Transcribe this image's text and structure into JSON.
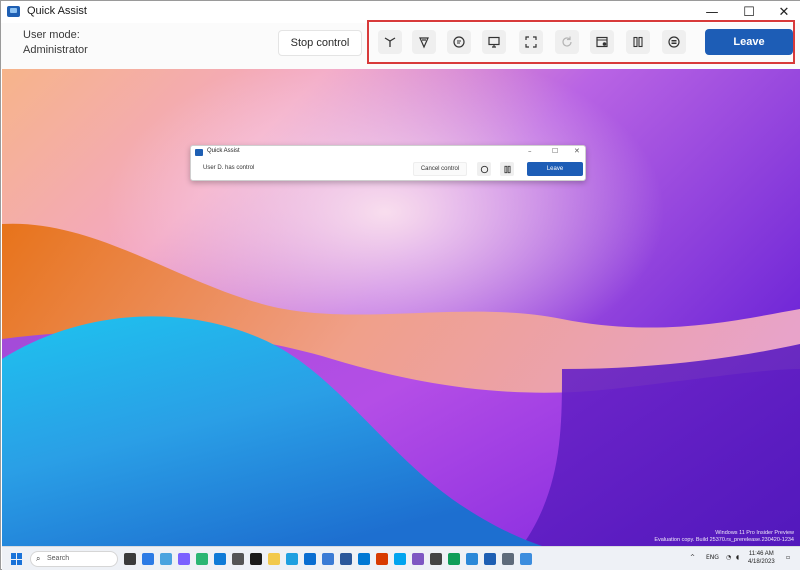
{
  "window": {
    "title": "Quick Assist",
    "controls": {
      "minimize": "—",
      "maximize": "☐",
      "close": "✕"
    }
  },
  "toolbar": {
    "user_mode_label": "User mode:",
    "user_mode_value": "Administrator",
    "stop_control_label": "Stop control",
    "leave_label": "Leave",
    "tools": [
      {
        "name": "laser-pointer-icon"
      },
      {
        "name": "annotate-icon"
      },
      {
        "name": "chat-icon"
      },
      {
        "name": "select-monitor-icon"
      },
      {
        "name": "fullscreen-icon"
      },
      {
        "name": "reconnect-icon"
      },
      {
        "name": "task-manager-icon"
      },
      {
        "name": "pause-icon"
      },
      {
        "name": "details-icon"
      }
    ],
    "highlight_color": "#d83a3a",
    "accent_color": "#1d5db6"
  },
  "remote_popup": {
    "title": "Quick Assist",
    "status": "User D. has control",
    "cancel_control_label": "Cancel control",
    "leave_label": "Leave"
  },
  "desktop": {
    "watermark_line1": "Windows 11 Pro Insider Preview",
    "watermark_line2": "Evaluation copy. Build 25370.rs_prerelease.230420-1234"
  },
  "taskbar": {
    "search_placeholder": "Search",
    "language": "ENG",
    "time": "11:46 AM",
    "date": "4/18/2023"
  }
}
